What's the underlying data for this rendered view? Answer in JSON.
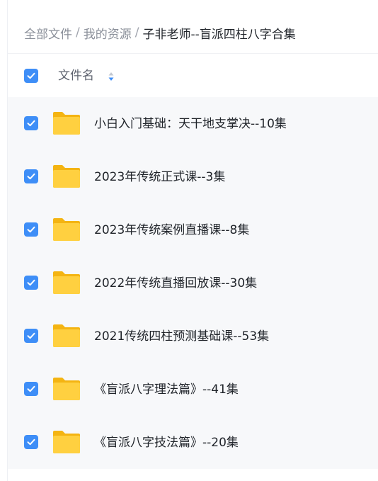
{
  "breadcrumb": {
    "items": [
      "全部文件",
      "我的资源"
    ],
    "separator": "/",
    "current": "子非老师--盲派四柱八字合集"
  },
  "list_header": {
    "select_all_checked": true,
    "column_name_label": "文件名",
    "sort_icon": "sort-arrows-icon"
  },
  "files": [
    {
      "name": "小白入门基础：天干地支掌决--10集",
      "type": "folder",
      "checked": true
    },
    {
      "name": "2023年传统正式课--3集",
      "type": "folder",
      "checked": true
    },
    {
      "name": "2023年传统案例直播课--8集",
      "type": "folder",
      "checked": true
    },
    {
      "name": "2022年传统直播回放课--30集",
      "type": "folder",
      "checked": true
    },
    {
      "name": "2021传统四柱预测基础课--53集",
      "type": "folder",
      "checked": true
    },
    {
      "name": "《盲派八字理法篇》--41集",
      "type": "folder",
      "checked": true
    },
    {
      "name": "《盲派八字技法篇》--20集",
      "type": "folder",
      "checked": true
    }
  ],
  "colors": {
    "accent": "#3e8ef7",
    "folder": "#ffc824",
    "list_background": "#f7f8fa"
  }
}
